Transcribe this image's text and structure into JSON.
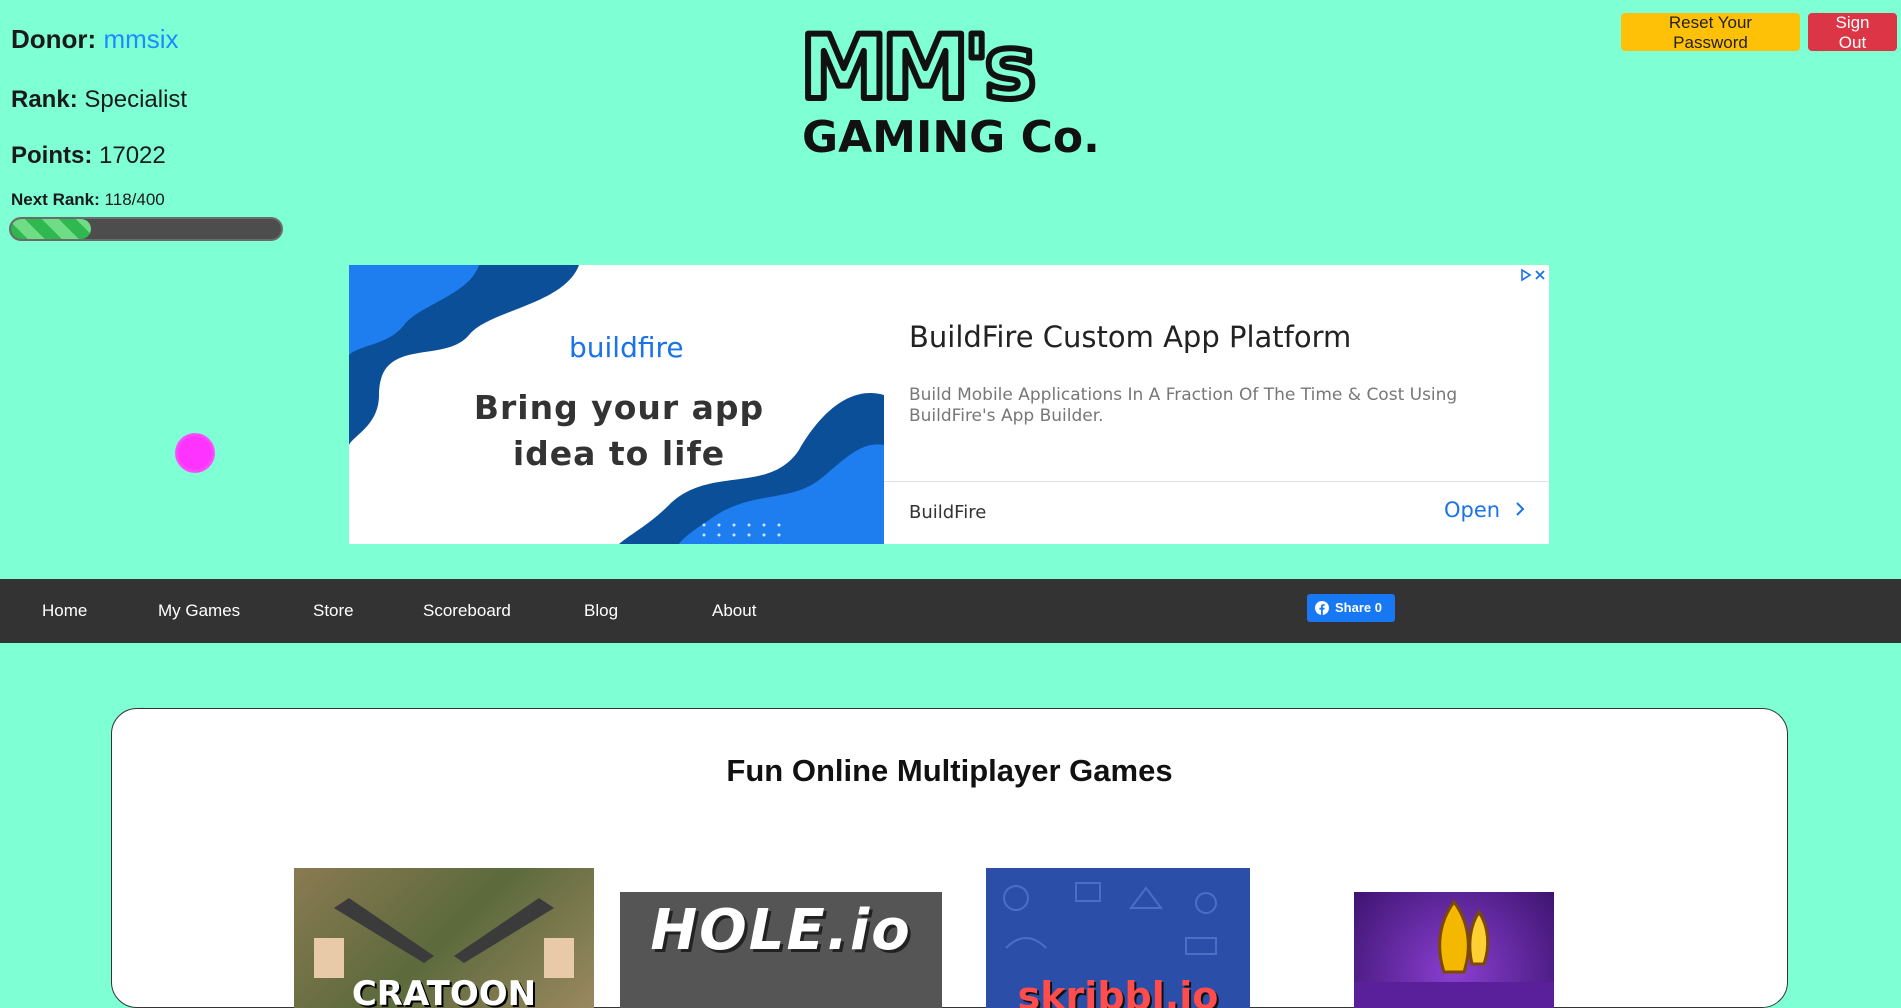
{
  "donor": {
    "donor_label": "Donor:",
    "donor_name": "mmsix",
    "rank_label": "Rank:",
    "rank_value": "Specialist",
    "points_label": "Points:",
    "points_value": "17022",
    "next_rank_label": "Next Rank:",
    "next_rank_value": "118/400",
    "next_rank_progress": 0.295
  },
  "logo": {
    "text_top": "MM's",
    "text_bottom": "GAMING Co."
  },
  "header_buttons": {
    "reset_password": "Reset Your Password",
    "sign_out": "Sign Out"
  },
  "ad": {
    "brand": "buildfire",
    "tagline_line1": "Bring your app",
    "tagline_line2": "idea to life",
    "title": "BuildFire Custom App Platform",
    "description": "Build Mobile Applications In A Fraction Of The Time & Cost Using BuildFire's App Builder.",
    "advertiser": "BuildFire",
    "cta": "Open"
  },
  "nav": {
    "items": [
      "Home",
      "My Games",
      "Store",
      "Scoreboard",
      "Blog",
      "About"
    ],
    "fb_share": "Share 0"
  },
  "main": {
    "title": "Fun Online Multiplayer Games",
    "thumbnails": [
      {
        "label": "CRATOON",
        "icon": "cartoon-strike-thumbnail"
      },
      {
        "label": "HOLE.io",
        "icon": "hole-io-thumbnail"
      },
      {
        "label": "skribbl.io",
        "icon": "skribbl-io-thumbnail"
      },
      {
        "label": "",
        "icon": "rocket-game-thumbnail"
      }
    ]
  },
  "colors": {
    "background": "#7fffd4",
    "nav": "#333333",
    "reset_button": "#ffc107",
    "signout_button": "#dc3545",
    "donor_name": "#1a8cff",
    "ad_blue": "#1a73e8"
  }
}
